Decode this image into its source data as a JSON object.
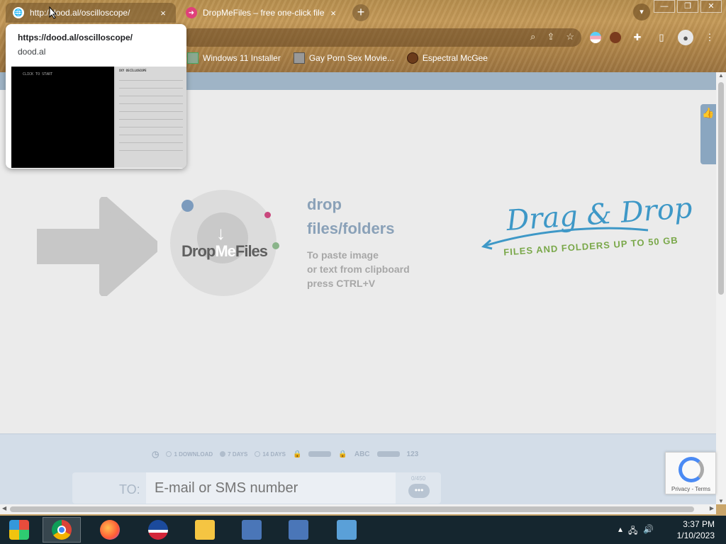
{
  "browser": {
    "tabs": [
      {
        "title": "http://dood.al/oscilloscope/",
        "close": "×",
        "favicon": "globe-icon",
        "active": true
      },
      {
        "title": "DropMeFiles – free one-click file",
        "close": "×",
        "favicon": "dropmefiles-icon",
        "active": false
      }
    ],
    "new_tab": "+",
    "window_controls": {
      "minimize": "—",
      "maximize": "❐",
      "close": "✕"
    },
    "bookmarks": [
      {
        "label": "Windows 11 Installer"
      },
      {
        "label": "Gay Porn Sex Movie..."
      },
      {
        "label": "Espectral McGee"
      }
    ]
  },
  "hovercard": {
    "url": "https://dood.al/oscilloscope/",
    "domain": "dood.al",
    "preview_scope_text": "CLICK TO START",
    "preview_panel_title": "XXY OSCILLOSCOPE"
  },
  "page": {
    "logo_drop": "Drop",
    "logo_me": "Me",
    "logo_files": "Files",
    "drop_title_1": "drop",
    "drop_title_2": "files/folders",
    "paste_hint_1": "To paste image",
    "paste_hint_2": "or text from clipboard",
    "paste_hint_3": "press CTRL+V",
    "drag_drop_title": "Drag & Drop",
    "drag_drop_sub": "FILES AND FOLDERS UP TO 50 GB",
    "options": {
      "one_download": "1 DOWNLOAD",
      "seven_days": "7 DAYS",
      "fourteen_days": "14 DAYS",
      "abc": "ABC",
      "num": "123"
    },
    "to_label": "TO:",
    "to_placeholder": "E-mail or SMS number",
    "to_counter": "0/450",
    "recaptcha_text": "Privacy - Terms"
  },
  "taskbar": {
    "time": "3:37 PM",
    "date": "1/10/2023"
  },
  "colors": {
    "accent_blue": "#3e98c7",
    "accent_green": "#7aa84a",
    "page_bg": "#ebebeb"
  }
}
